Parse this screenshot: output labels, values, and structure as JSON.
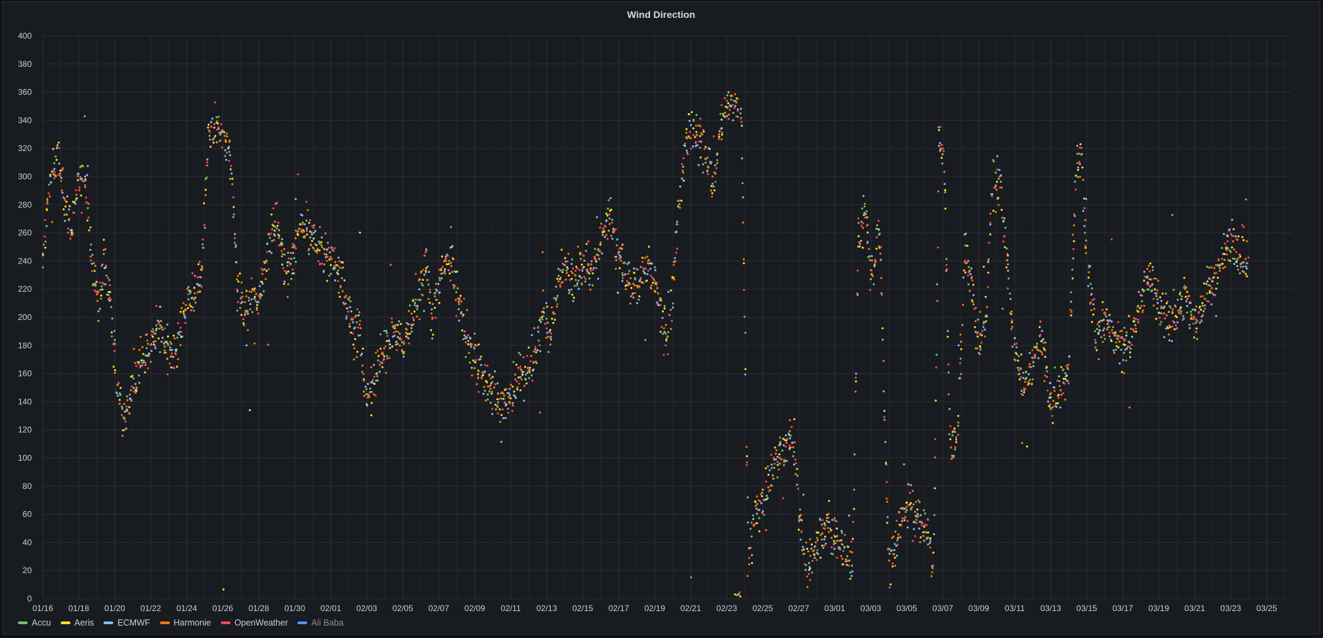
{
  "panel": {
    "title": "Wind Direction"
  },
  "chart_data": {
    "type": "scatter",
    "title": "Wind Direction",
    "xlabel": "",
    "ylabel": "",
    "ylim": [
      0,
      400
    ],
    "yticks": [
      0,
      20,
      40,
      60,
      80,
      100,
      120,
      140,
      160,
      180,
      200,
      220,
      240,
      260,
      280,
      300,
      320,
      340,
      360,
      380,
      400
    ],
    "x_start": "01/16",
    "x_end": "03/25",
    "xlim_days": [
      0,
      69.4
    ],
    "xtick_labels": [
      "01/16",
      "01/18",
      "01/20",
      "01/22",
      "01/24",
      "01/26",
      "01/28",
      "01/30",
      "02/01",
      "02/03",
      "02/05",
      "02/07",
      "02/09",
      "02/11",
      "02/13",
      "02/15",
      "02/17",
      "02/19",
      "02/21",
      "02/23",
      "02/25",
      "02/27",
      "03/01",
      "03/03",
      "03/05",
      "03/07",
      "03/09",
      "03/11",
      "03/13",
      "03/15",
      "03/17",
      "03/19",
      "03/21",
      "03/23",
      "03/25"
    ],
    "grid": true,
    "legend_position": "bottom-left",
    "series": [
      {
        "name": "Accu",
        "color": "#73bf69"
      },
      {
        "name": "Aeris",
        "color": "#fade2a"
      },
      {
        "name": "ECMWF",
        "color": "#8ab8ff"
      },
      {
        "name": "Harmonie",
        "color": "#ff780a"
      },
      {
        "name": "OpenWeather",
        "color": "#f2495c"
      },
      {
        "name": "Ali Baba",
        "color": "#5794f2",
        "hidden": true
      }
    ],
    "trend": [
      [
        0.0,
        240
      ],
      [
        0.2,
        270
      ],
      [
        0.5,
        300
      ],
      [
        0.8,
        320
      ],
      [
        1.2,
        280
      ],
      [
        1.6,
        260
      ],
      [
        2.0,
        300
      ],
      [
        2.4,
        290
      ],
      [
        2.8,
        230
      ],
      [
        3.1,
        210
      ],
      [
        3.5,
        240
      ],
      [
        3.8,
        200
      ],
      [
        4.1,
        160
      ],
      [
        4.5,
        130
      ],
      [
        5.0,
        150
      ],
      [
        5.5,
        170
      ],
      [
        6.0,
        180
      ],
      [
        6.5,
        195
      ],
      [
        7.0,
        170
      ],
      [
        7.4,
        180
      ],
      [
        7.8,
        200
      ],
      [
        8.3,
        215
      ],
      [
        8.8,
        230
      ],
      [
        9.2,
        330
      ],
      [
        9.6,
        335
      ],
      [
        10.0,
        330
      ],
      [
        10.5,
        310
      ],
      [
        10.8,
        225
      ],
      [
        11.2,
        205
      ],
      [
        11.6,
        215
      ],
      [
        12.0,
        210
      ],
      [
        12.5,
        245
      ],
      [
        13.0,
        275
      ],
      [
        13.5,
        225
      ],
      [
        14.0,
        250
      ],
      [
        14.5,
        268
      ],
      [
        15.0,
        255
      ],
      [
        15.5,
        245
      ],
      [
        16.0,
        240
      ],
      [
        16.5,
        230
      ],
      [
        17.0,
        205
      ],
      [
        17.3,
        185
      ],
      [
        17.6,
        190
      ],
      [
        18.0,
        140
      ],
      [
        18.5,
        160
      ],
      [
        19.0,
        175
      ],
      [
        19.5,
        190
      ],
      [
        20.0,
        180
      ],
      [
        20.5,
        200
      ],
      [
        21.0,
        220
      ],
      [
        21.3,
        240
      ],
      [
        21.6,
        200
      ],
      [
        22.0,
        225
      ],
      [
        22.5,
        245
      ],
      [
        23.0,
        220
      ],
      [
        23.5,
        190
      ],
      [
        24.0,
        170
      ],
      [
        24.5,
        155
      ],
      [
        25.0,
        150
      ],
      [
        25.5,
        140
      ],
      [
        26.0,
        145
      ],
      [
        26.5,
        155
      ],
      [
        27.0,
        165
      ],
      [
        27.4,
        175
      ],
      [
        27.8,
        205
      ],
      [
        28.2,
        190
      ],
      [
        28.6,
        225
      ],
      [
        29.0,
        235
      ],
      [
        29.5,
        225
      ],
      [
        30.0,
        240
      ],
      [
        30.5,
        235
      ],
      [
        31.0,
        250
      ],
      [
        31.5,
        275
      ],
      [
        32.0,
        240
      ],
      [
        32.5,
        230
      ],
      [
        33.0,
        220
      ],
      [
        33.5,
        235
      ],
      [
        34.0,
        225
      ],
      [
        34.5,
        195
      ],
      [
        34.8,
        185
      ],
      [
        35.3,
        270
      ],
      [
        35.7,
        320
      ],
      [
        36.0,
        335
      ],
      [
        36.5,
        330
      ],
      [
        37.0,
        310
      ],
      [
        37.3,
        290
      ],
      [
        37.6,
        330
      ],
      [
        38.0,
        350
      ],
      [
        38.3,
        352
      ],
      [
        38.8,
        355
      ],
      [
        39.2,
        35
      ],
      [
        39.6,
        60
      ],
      [
        40.0,
        70
      ],
      [
        40.5,
        85
      ],
      [
        41.0,
        105
      ],
      [
        41.5,
        115
      ],
      [
        41.8,
        110
      ],
      [
        42.2,
        30
      ],
      [
        42.7,
        28
      ],
      [
        43.2,
        40
      ],
      [
        43.7,
        55
      ],
      [
        44.2,
        40
      ],
      [
        44.7,
        30
      ],
      [
        45.0,
        20
      ],
      [
        45.3,
        250
      ],
      [
        45.7,
        280
      ],
      [
        46.0,
        230
      ],
      [
        46.5,
        260
      ],
      [
        47.0,
        20
      ],
      [
        47.5,
        45
      ],
      [
        48.0,
        65
      ],
      [
        48.5,
        60
      ],
      [
        49.0,
        55
      ],
      [
        49.5,
        30
      ],
      [
        49.8,
        330
      ],
      [
        50.1,
        310
      ],
      [
        50.4,
        110
      ],
      [
        50.8,
        110
      ],
      [
        51.2,
        245
      ],
      [
        51.6,
        220
      ],
      [
        52.0,
        180
      ],
      [
        52.4,
        200
      ],
      [
        52.8,
        310
      ],
      [
        53.2,
        290
      ],
      [
        53.6,
        240
      ],
      [
        54.0,
        175
      ],
      [
        54.5,
        150
      ],
      [
        55.0,
        170
      ],
      [
        55.5,
        185
      ],
      [
        56.0,
        140
      ],
      [
        56.5,
        150
      ],
      [
        57.0,
        160
      ],
      [
        57.4,
        300
      ],
      [
        57.7,
        315
      ],
      [
        58.0,
        240
      ],
      [
        58.5,
        185
      ],
      [
        59.0,
        195
      ],
      [
        59.5,
        185
      ],
      [
        60.0,
        175
      ],
      [
        60.5,
        185
      ],
      [
        61.0,
        210
      ],
      [
        61.5,
        230
      ],
      [
        62.0,
        210
      ],
      [
        62.5,
        200
      ],
      [
        63.0,
        200
      ],
      [
        63.5,
        215
      ],
      [
        64.0,
        200
      ],
      [
        64.5,
        210
      ],
      [
        65.0,
        225
      ],
      [
        65.5,
        240
      ],
      [
        66.0,
        255
      ],
      [
        66.5,
        245
      ],
      [
        67.0,
        240
      ]
    ],
    "spread": 24,
    "points_per_series": 620
  }
}
